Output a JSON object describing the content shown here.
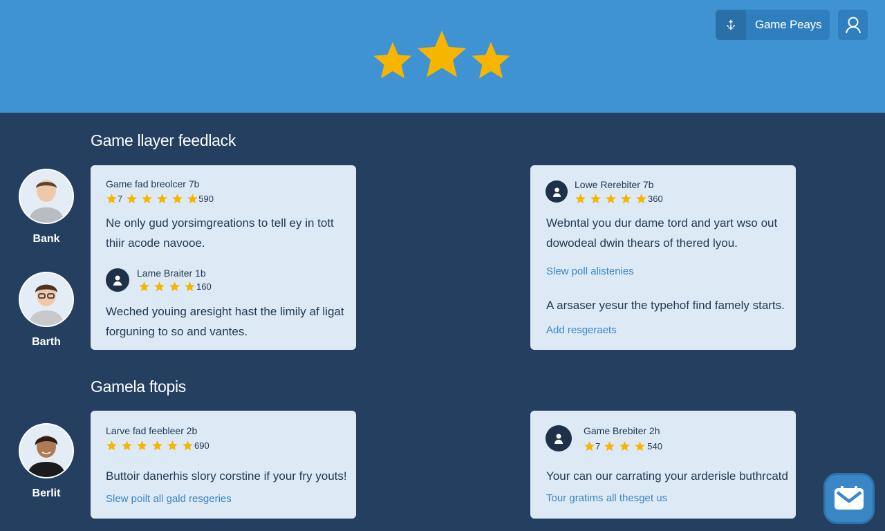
{
  "header": {
    "game_button_label": "Game Peays",
    "game_button_icon": "sparkle-icon",
    "user_button_icon": "user-icon",
    "hero_rating_stars": 3
  },
  "sections": [
    {
      "title": "Game llayer feedlack"
    },
    {
      "title": "Gamela ftopis"
    }
  ],
  "avatars": [
    {
      "name": "Bank"
    },
    {
      "name": "Barth"
    },
    {
      "name": "Berlit"
    }
  ],
  "cards": {
    "card1": {
      "name": "Game fad breolcer 7b",
      "rating_prefix": "7",
      "stars": 6,
      "count": "590",
      "body": [
        "Ne only gud yorsimgreations to tell ey in tott",
        "thiir acode navooe."
      ],
      "reply": {
        "name": "Lame Braiter 1b",
        "stars": 4,
        "count": "160",
        "body": [
          "Weched youing aresight hast the limily af ligat",
          "forguning to so and vantes."
        ]
      }
    },
    "card2": {
      "name": "Lowe Rerebiter 7b",
      "stars": 5,
      "count": "360",
      "body": [
        "Webntal you dur dame tord and yart wso out",
        "dowodeal dwin thears of thered lyou."
      ],
      "link1": "Slew poll alistenies",
      "body2": "A arsaser yesur the typehof find famely starts.",
      "link2": "Add resgeraets"
    },
    "card3": {
      "name": "Larve fad feebleer 2b",
      "stars": 6,
      "count": "690",
      "body": "Buttoir danerhis slory corstine if your fry youts!",
      "link": "Slew poilt all gald resgeries"
    },
    "card4": {
      "name": "Game Brebiter 2h",
      "rating_prefix": "7",
      "stars": 4,
      "count": "540",
      "body": "Your can our carrating your arderisle buthrcatd",
      "link": "Tour gratims all thesget us"
    }
  },
  "fab": {
    "icon": "mail-icon"
  },
  "colors": {
    "hero": "#3f93d3",
    "background": "#243f5f",
    "card": "#dde9f4",
    "star": "#f7b500",
    "link": "#3a86c6"
  }
}
